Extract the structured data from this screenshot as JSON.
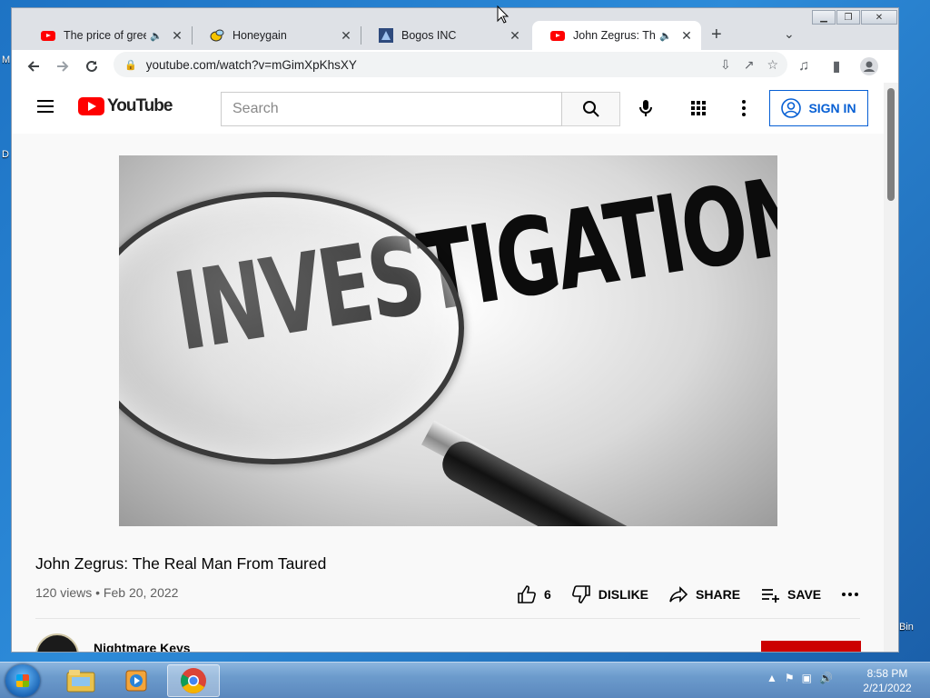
{
  "desktop": {
    "left_label": "M",
    "left_label2": "D",
    "recycle_label": "Bin"
  },
  "tabs": [
    {
      "title": "The price of green",
      "audio": true,
      "favicon": "youtube-icon"
    },
    {
      "title": "Honeygain",
      "audio": false,
      "favicon": "honeygain-icon"
    },
    {
      "title": "Bogos INC",
      "audio": false,
      "favicon": "bogos-icon"
    },
    {
      "title": "John Zegrus: The R",
      "audio": true,
      "favicon": "youtube-icon",
      "active": true
    }
  ],
  "address_bar": {
    "url": "youtube.com/watch?v=mGimXpKhsXY"
  },
  "youtube": {
    "logo_text": "YouTube",
    "search_placeholder": "Search",
    "sign_in_label": "SIGN IN"
  },
  "video": {
    "thumbnail_text": "INVESTIGATION",
    "title": "John Zegrus: The Real Man From Taured",
    "meta": "120 views • Feb 20, 2022",
    "likes": "6",
    "dislike_label": "DISLIKE",
    "share_label": "SHARE",
    "save_label": "SAVE",
    "channel_name": "Nightmare Keys",
    "subscribe_label": "SUBSCRIBE"
  },
  "taskbar": {
    "time": "8:58 PM",
    "date": "2/21/2022"
  },
  "colors": {
    "yt_red": "#ff0000",
    "signin_blue": "#065fd4",
    "subscribe_red": "#cc0000"
  }
}
